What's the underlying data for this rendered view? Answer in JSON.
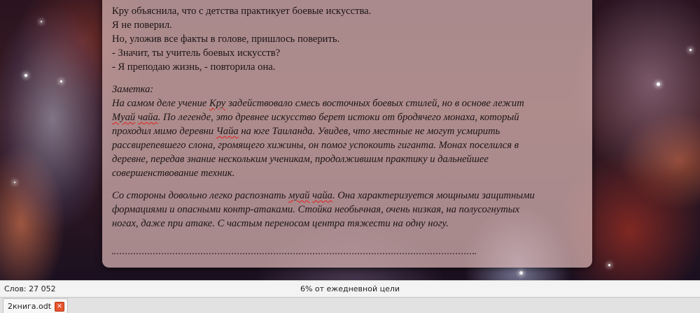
{
  "document": {
    "lines_top": [
      "Кру объяснила, что с детства практикует боевые искусства.",
      "Я не поверил.",
      "Но, уложив все факты в голове, пришлось поверить.",
      "- Значит, ты учитель боевых искусств?",
      "- Я преподаю жизнь, - повторила она."
    ],
    "note_heading": "Заметка:",
    "note_p1": {
      "s1": "На самом деле учение ",
      "w1": "Кру",
      "s2": " задействовало смесь восточных боевых стилей, но в основе лежит",
      "w2": "Муай",
      "s3": " ",
      "w3": "чайа",
      "s4": ". По легенде, это древнее искусство берет истоки от бродячего монаха, который",
      "s5": "проходил мимо деревни ",
      "w4": "Чайа",
      "s6": " на юге Таиланда. Увидев, что местные не могут усмирить",
      "s7": "рассвирепевшего слона, громящего хижины, он помог успокоить гиганта. Монах поселился в",
      "s8": "деревне, передав знание нескольким ученикам, продолжившим практику и дальнейшее",
      "s9": "совершенствование техник."
    },
    "note_p2": {
      "s1": "Со стороны довольно легко распознать ",
      "w1": "муай",
      "s2": " ",
      "w2": "чайа",
      "s3": ". Она характеризуется мощными защитными",
      "s4": "формациями и опасными контр-атаками. Стойка необычная, очень низкая, на полусогнутых",
      "s5": "ногах, даже при атаке. С частым переносом центра тяжести на одну ногу."
    }
  },
  "statusbar": {
    "word_count": "Слов: 27 052",
    "daily_goal": "6% от ежедневной цели"
  },
  "tabs": [
    {
      "label": "2книга.odt",
      "close_icon": "close-icon"
    }
  ],
  "colors": {
    "page_tint": "#d6b4b2",
    "spellcheck_underline": "#e0201c",
    "tab_close": "#e8542f"
  }
}
